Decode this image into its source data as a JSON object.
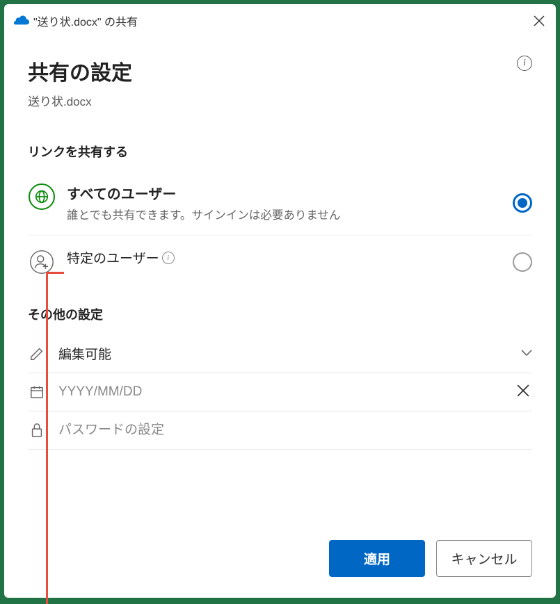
{
  "titlebar": {
    "text": "\"送り状.docx\" の共有"
  },
  "header": {
    "title": "共有の設定",
    "filename": "送り状.docx"
  },
  "share_link": {
    "section_title": "リンクを共有する",
    "options": [
      {
        "title": "すべてのユーザー",
        "desc": "誰とでも共有できます。サインインは必要ありません"
      },
      {
        "title": "特定のユーザー"
      }
    ]
  },
  "other_settings": {
    "section_title": "その他の設定",
    "permission_label": "編集可能",
    "date_placeholder": "YYYY/MM/DD",
    "password_placeholder": "パスワードの設定"
  },
  "buttons": {
    "apply": "適用",
    "cancel": "キャンセル"
  }
}
